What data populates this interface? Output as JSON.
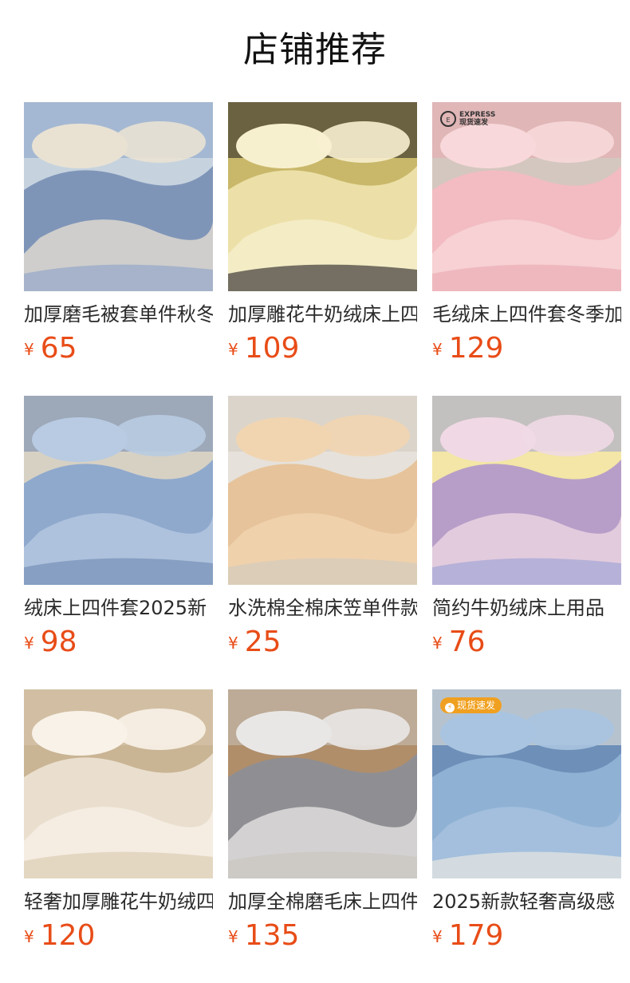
{
  "section": {
    "title": "店铺推荐"
  },
  "currency": "¥",
  "colors": {
    "price": "#e84c17",
    "badge": "#f0a020"
  },
  "products": [
    {
      "name": "加厚磨毛被套单件秋冬",
      "price": "65",
      "image": "blue-floral-bedding",
      "palette": [
        "#7f95b8",
        "#e9e2d3",
        "#8aa2c8",
        "#c6d3df"
      ]
    },
    {
      "name": "加厚雕花牛奶绒床上四",
      "price": "109",
      "image": "yellow-carved-bedding",
      "palette": [
        "#ece0a8",
        "#f7f0cf",
        "#1e1c1f",
        "#c9b86a"
      ]
    },
    {
      "name": "毛绒床上四件套冬季加",
      "price": "129",
      "image": "pink-plush-bedding",
      "palette": [
        "#f2bcc2",
        "#f8d8da",
        "#e9a7b1",
        "#d4c7bf"
      ],
      "badge": {
        "mark": "E",
        "line1": "EXPRESS",
        "line2": "现货速发"
      }
    },
    {
      "name": "绒床上四件套2025新",
      "price": "98",
      "image": "blue-rabbit-fur-bedding",
      "palette": [
        "#8fa9cd",
        "#b8cbe2",
        "#6d87b0",
        "#d7d1c4"
      ]
    },
    {
      "name": "水洗棉全棉床笠单件款",
      "price": "25",
      "image": "striped-fitted-sheet",
      "palette": [
        "#e6c39a",
        "#f1d5b1",
        "#cfcac0",
        "#e6e1da"
      ]
    },
    {
      "name": "简约牛奶绒床上用品",
      "price": "76",
      "image": "pastel-dots-bedding",
      "palette": [
        "#b79ec8",
        "#f0d9e4",
        "#9aa0d6",
        "#f3e6a6"
      ]
    },
    {
      "name": "轻奢加厚雕花牛奶绒四",
      "price": "120",
      "image": "cream-bedding",
      "palette": [
        "#eadfce",
        "#f8f2e8",
        "#d8c8ae",
        "#c9b494"
      ]
    },
    {
      "name": "加厚全棉磨毛床上四件",
      "price": "135",
      "image": "grey-white-bedding",
      "palette": [
        "#8f8f93",
        "#e9e7e6",
        "#c9c3bc",
        "#b08e6a"
      ]
    },
    {
      "name": "2025新款轻奢高级感",
      "price": "179",
      "image": "light-blue-satin-bedding",
      "palette": [
        "#8fb1d4",
        "#a9c4e0",
        "#f3eee2",
        "#6e8fb8"
      ],
      "tag": {
        "icon": "lightning-icon",
        "label": "现货速发"
      }
    }
  ]
}
